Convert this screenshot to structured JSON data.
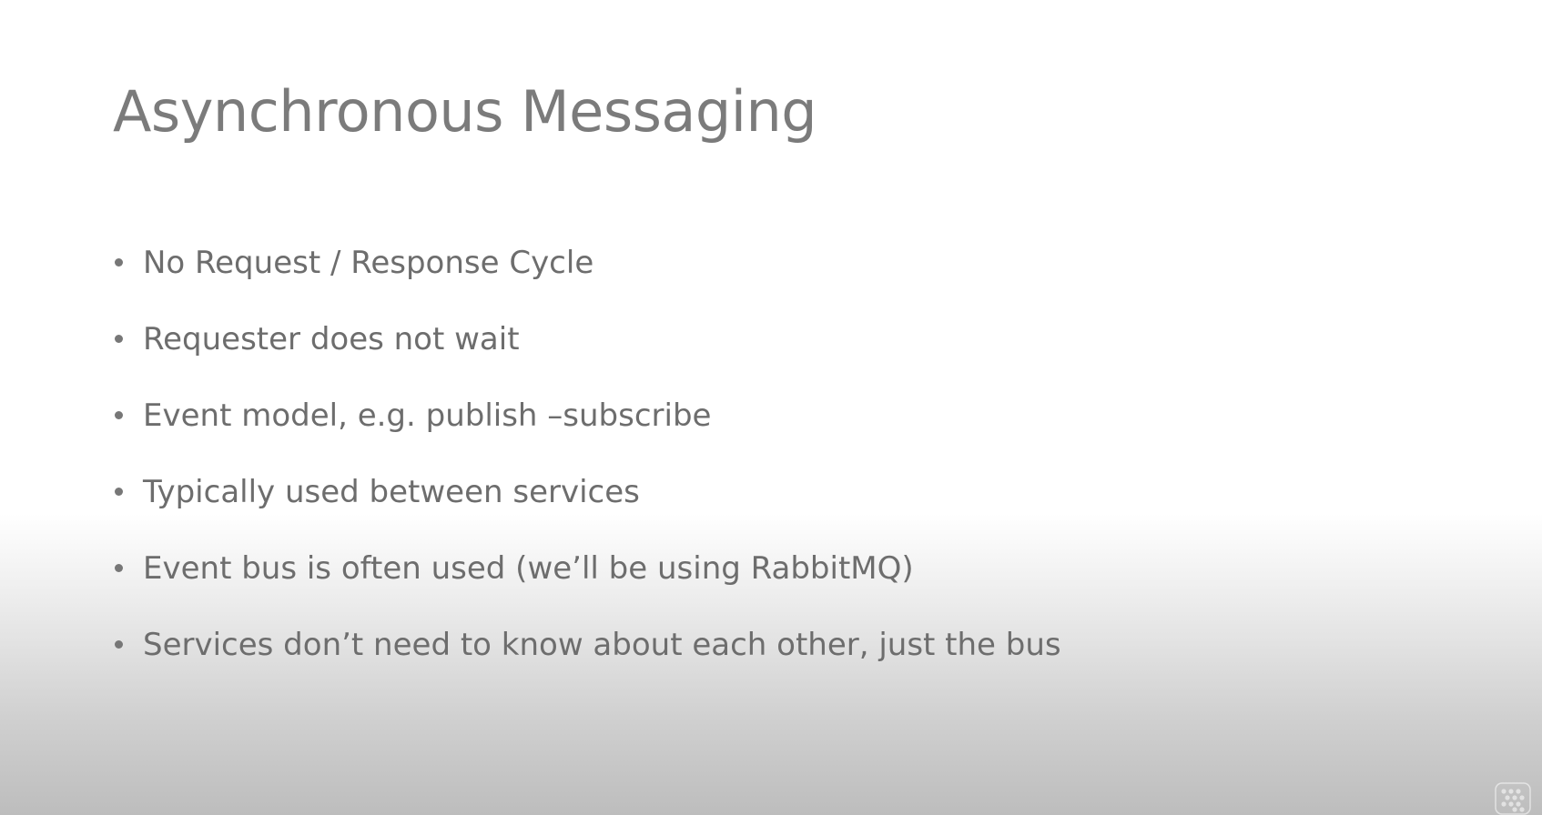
{
  "slide": {
    "title": "Asynchronous Messaging",
    "bullets": [
      "No Request / Response Cycle",
      "Requester does not wait",
      "Event model, e.g. publish –subscribe",
      "Typically used between services",
      "Event bus is often used (we’ll be using RabbitMQ)",
      "Services don’t need to know about each other, just the bus"
    ]
  },
  "colors": {
    "title_text": "#7b7b7b",
    "body_text": "#6d6d6d",
    "background_top": "#ffffff",
    "background_bottom": "#bdbdbd"
  },
  "icons": {
    "watermark": "dotted-logo-icon"
  }
}
